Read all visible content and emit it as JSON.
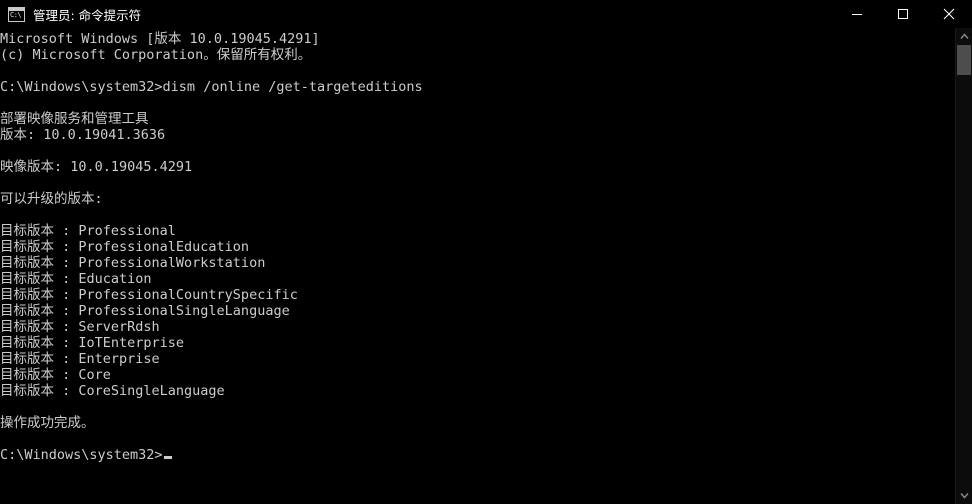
{
  "window": {
    "title": "管理员: 命令提示符",
    "icon_name": "console-icon",
    "icon_text": "C:\\",
    "background_color": "#000000",
    "text_color": "#cccccc"
  },
  "titlebar_buttons": {
    "minimize_label": "最小化",
    "maximize_label": "最大化",
    "close_label": "关闭"
  },
  "console": {
    "lines": [
      "Microsoft Windows [版本 10.0.19045.4291]",
      "(c) Microsoft Corporation。保留所有权利。",
      "",
      "C:\\Windows\\system32>dism /online /get-targeteditions",
      "",
      "部署映像服务和管理工具",
      "版本: 10.0.19041.3636",
      "",
      "映像版本: 10.0.19045.4291",
      "",
      "可以升级的版本:",
      "",
      "目标版本 : Professional",
      "目标版本 : ProfessionalEducation",
      "目标版本 : ProfessionalWorkstation",
      "目标版本 : Education",
      "目标版本 : ProfessionalCountrySpecific",
      "目标版本 : ProfessionalSingleLanguage",
      "目标版本 : ServerRdsh",
      "目标版本 : IoTEnterprise",
      "目标版本 : Enterprise",
      "目标版本 : Core",
      "目标版本 : CoreSingleLanguage",
      "",
      "操作成功完成。",
      ""
    ],
    "prompt": "C:\\Windows\\system32>",
    "command": "dism /online /get-targeteditions",
    "dism_tool_name": "部署映像服务和管理工具",
    "dism_version": "版本: 10.0.19041.3636",
    "image_version": "映像版本: 10.0.19045.4291",
    "upgradable_header": "可以升级的版本:",
    "target_edition_label": "目标版本 :",
    "editions": [
      "Professional",
      "ProfessionalEducation",
      "ProfessionalWorkstation",
      "Education",
      "ProfessionalCountrySpecific",
      "ProfessionalSingleLanguage",
      "ServerRdsh",
      "IoTEnterprise",
      "Enterprise",
      "Core",
      "CoreSingleLanguage"
    ],
    "result_message": "操作成功完成。",
    "copyright": "(c) Microsoft Corporation。保留所有权利。",
    "os_banner": "Microsoft Windows [版本 10.0.19045.4291]"
  },
  "scrollbar": {
    "up_arrow_name": "scroll-up-arrow",
    "down_arrow_name": "scroll-down-arrow"
  }
}
